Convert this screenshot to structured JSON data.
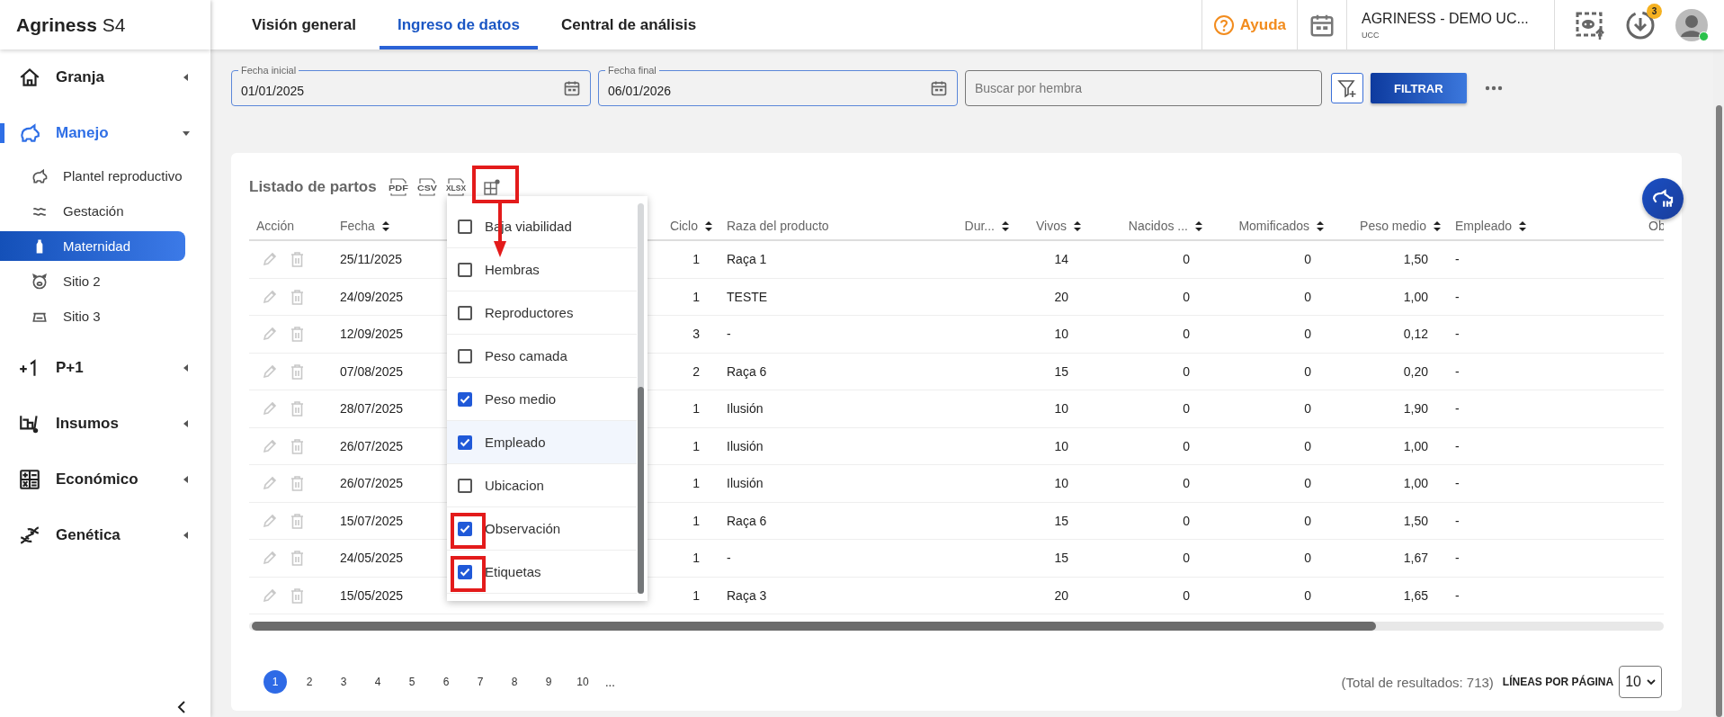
{
  "sidebar": {
    "logo": "**Agriness** S4",
    "items": [
      {
        "kind": "house",
        "label": "Granja",
        "selected": false,
        "expanded": false
      },
      {
        "kind": "pig",
        "label": "Manejo",
        "selected": true,
        "expanded": true,
        "children": [
          {
            "kind": "pig",
            "label": "Plantel reproductivo",
            "selected": false
          },
          {
            "kind": "wave",
            "label": "Gestación",
            "selected": false
          },
          {
            "kind": "bottle",
            "label": "Maternidad",
            "selected": true
          },
          {
            "kind": "pigface",
            "label": "Sitio 2",
            "selected": false
          },
          {
            "kind": "scale",
            "label": "Sitio 3",
            "selected": false
          }
        ]
      },
      {
        "kind": "plus",
        "label": "P+1",
        "selected": false,
        "expanded": false
      },
      {
        "kind": "cart",
        "label": "Insumos",
        "selected": false,
        "expanded": false
      },
      {
        "kind": "calc",
        "label": "Económico",
        "selected": false,
        "expanded": false
      },
      {
        "kind": "dna",
        "label": "Genética",
        "selected": false,
        "expanded": false
      }
    ]
  },
  "tabs": [
    {
      "label": "Visión general",
      "selected": false
    },
    {
      "label": "Ingreso de datos",
      "selected": true
    },
    {
      "label": "Central de análisis",
      "selected": false
    }
  ],
  "header": {
    "help": "Ayuda",
    "org_name": "AGRINESS - DEMO UC...",
    "org_code": "UCC",
    "downloads_badge": "3",
    "user_online": true
  },
  "filters": {
    "start_date": {
      "label": "Fecha inicial",
      "value": "01/01/2025"
    },
    "end_date": {
      "label": "Fecha final",
      "value": "06/01/2026"
    },
    "search": {
      "placeholder": "Buscar por hembra"
    },
    "filter_button": "FILTRAR"
  },
  "card": {
    "title": "Listado de partos",
    "exports": [
      "PDF",
      "CSV",
      "XLSX"
    ],
    "column_settings_highlighted": true
  },
  "columns": [
    {
      "label": "Acción",
      "kind": "action",
      "sortable": false
    },
    {
      "label": "Fecha",
      "kind": "text",
      "sortable": true
    },
    {
      "label": "Ciclo",
      "kind": "number",
      "sortable": true
    },
    {
      "label": "Raza del producto",
      "kind": "text",
      "sortable": false
    },
    {
      "label": "Dur...",
      "kind": "number",
      "sortable": true
    },
    {
      "label": "Vivos",
      "kind": "number",
      "sortable": true
    },
    {
      "label": "Nacidos ...",
      "kind": "number",
      "sortable": true
    },
    {
      "label": "Momificados",
      "kind": "number",
      "sortable": true
    },
    {
      "label": "Peso medio",
      "kind": "number",
      "sortable": true
    },
    {
      "label": "Empleado",
      "kind": "text",
      "sortable": true
    },
    {
      "label": "Ob",
      "kind": "text",
      "sortable": false
    }
  ],
  "rows": [
    [
      null,
      "25/11/2025",
      "1",
      "Raça 1",
      null,
      "14",
      "0",
      "0",
      "1,50",
      "-",
      null
    ],
    [
      null,
      "24/09/2025",
      "1",
      "TESTE",
      null,
      "20",
      "0",
      "0",
      "1,00",
      "-",
      null
    ],
    [
      null,
      "12/09/2025",
      "3",
      "-",
      null,
      "10",
      "0",
      "0",
      "0,12",
      "-",
      null
    ],
    [
      null,
      "07/08/2025",
      "2",
      "Raça 6",
      null,
      "15",
      "0",
      "0",
      "0,20",
      "-",
      null
    ],
    [
      null,
      "28/07/2025",
      "1",
      "Ilusión",
      null,
      "10",
      "0",
      "0",
      "1,90",
      "-",
      null
    ],
    [
      null,
      "26/07/2025",
      "1",
      "Ilusión",
      null,
      "10",
      "0",
      "0",
      "1,00",
      "-",
      null
    ],
    [
      null,
      "26/07/2025",
      "1",
      "Ilusión",
      null,
      "10",
      "0",
      "0",
      "1,00",
      "-",
      null
    ],
    [
      null,
      "15/07/2025",
      "1",
      "Raça 6",
      null,
      "15",
      "0",
      "0",
      "1,50",
      "-",
      null
    ],
    [
      null,
      "24/05/2025",
      "1",
      "-",
      null,
      "15",
      "0",
      "0",
      "1,67",
      "-",
      null
    ],
    [
      null,
      "15/05/2025",
      "1",
      "Raça 3",
      null,
      "20",
      "0",
      "0",
      "1,65",
      "-",
      null
    ]
  ],
  "column_menu": [
    {
      "label": "Baja viabilidad",
      "checked": false,
      "hovered": false,
      "highlighted": false
    },
    {
      "label": "Hembras",
      "checked": false,
      "hovered": false,
      "highlighted": false
    },
    {
      "label": "Reproductores",
      "checked": false,
      "hovered": false,
      "highlighted": false
    },
    {
      "label": "Peso camada",
      "checked": false,
      "hovered": false,
      "highlighted": false
    },
    {
      "label": "Peso medio",
      "checked": true,
      "hovered": false,
      "highlighted": false
    },
    {
      "label": "Empleado",
      "checked": true,
      "hovered": true,
      "highlighted": false
    },
    {
      "label": "Ubicacion",
      "checked": false,
      "hovered": false,
      "highlighted": false
    },
    {
      "label": "Observación",
      "checked": true,
      "hovered": false,
      "highlighted": true
    },
    {
      "label": "Etiquetas",
      "checked": true,
      "hovered": false,
      "highlighted": true
    }
  ],
  "pagination": {
    "pages": [
      {
        "label": "1",
        "selected": true
      },
      {
        "label": "2",
        "selected": false
      },
      {
        "label": "3",
        "selected": false
      },
      {
        "label": "4",
        "selected": false
      },
      {
        "label": "5",
        "selected": false
      },
      {
        "label": "6",
        "selected": false
      },
      {
        "label": "7",
        "selected": false
      },
      {
        "label": "8",
        "selected": false
      },
      {
        "label": "9",
        "selected": false
      },
      {
        "label": "10",
        "selected": false
      }
    ],
    "ellipsis": "...",
    "total": "(Total de resultados: 713)",
    "per_page_label": "LÍNEAS POR PÁGINA",
    "per_page": "10"
  }
}
